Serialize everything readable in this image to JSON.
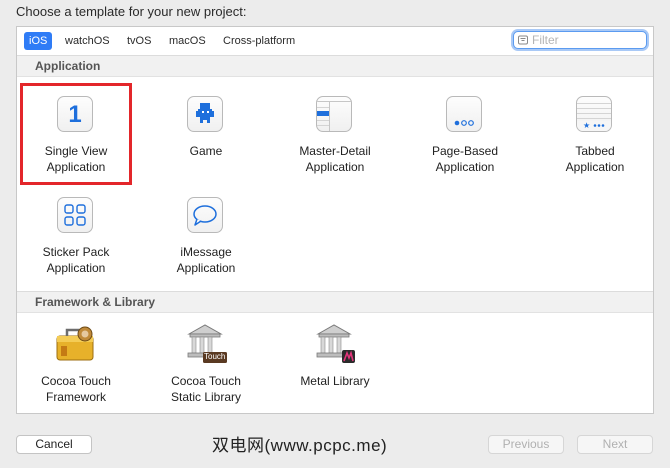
{
  "dialog": {
    "heading": "Choose a template for your new project:"
  },
  "tabs": [
    {
      "label": "iOS",
      "active": true
    },
    {
      "label": "watchOS"
    },
    {
      "label": "tvOS"
    },
    {
      "label": "macOS"
    },
    {
      "label": "Cross-platform"
    }
  ],
  "filter": {
    "placeholder": "Filter",
    "value": ""
  },
  "sections": {
    "application": {
      "title": "Application",
      "items": [
        {
          "label": "Single View\nApplication",
          "icon": "single-view-icon",
          "glyph": "1",
          "selected": true
        },
        {
          "label": "Game",
          "icon": "game-icon"
        },
        {
          "label": "Master-Detail\nApplication",
          "icon": "master-detail-icon"
        },
        {
          "label": "Page-Based\nApplication",
          "icon": "page-based-icon"
        },
        {
          "label": "Tabbed\nApplication",
          "icon": "tabbed-icon"
        },
        {
          "label": "Sticker Pack\nApplication",
          "icon": "sticker-pack-icon"
        },
        {
          "label": "iMessage\nApplication",
          "icon": "imessage-icon"
        }
      ]
    },
    "framework": {
      "title": "Framework & Library",
      "items": [
        {
          "label": "Cocoa Touch\nFramework",
          "icon": "toolbox-icon"
        },
        {
          "label": "Cocoa Touch\nStatic Library",
          "icon": "static-library-icon",
          "badge": "Touch"
        },
        {
          "label": "Metal Library",
          "icon": "metal-library-icon"
        }
      ]
    }
  },
  "buttons": {
    "cancel": "Cancel",
    "previous": "Previous",
    "next": "Next"
  },
  "watermark": "双电网(www.pcpc.me)",
  "colors": {
    "accent": "#2f7cf6",
    "selection_frame": "#e3262a",
    "icon_blue": "#1e6fdc"
  }
}
